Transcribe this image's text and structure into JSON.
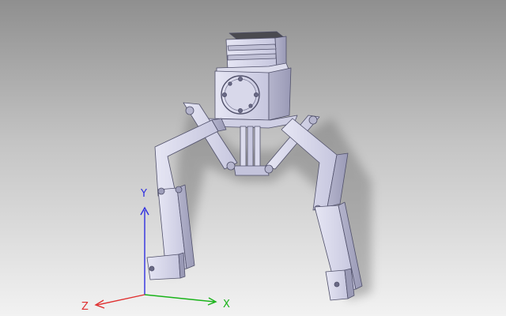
{
  "viewport": {
    "background_top": "#8f8f8f",
    "background_bottom": "#f2f2f2",
    "model_color": "#d2d2e6",
    "model_shadow": "#a6a6c4",
    "model_edge": "#50506a"
  },
  "triad": {
    "y_axis": {
      "label": "Y",
      "color": "#2f2fe0"
    },
    "x_axis": {
      "label": "X",
      "color": "#19b319"
    },
    "z_axis": {
      "label": "Z",
      "color": "#e03030"
    }
  }
}
